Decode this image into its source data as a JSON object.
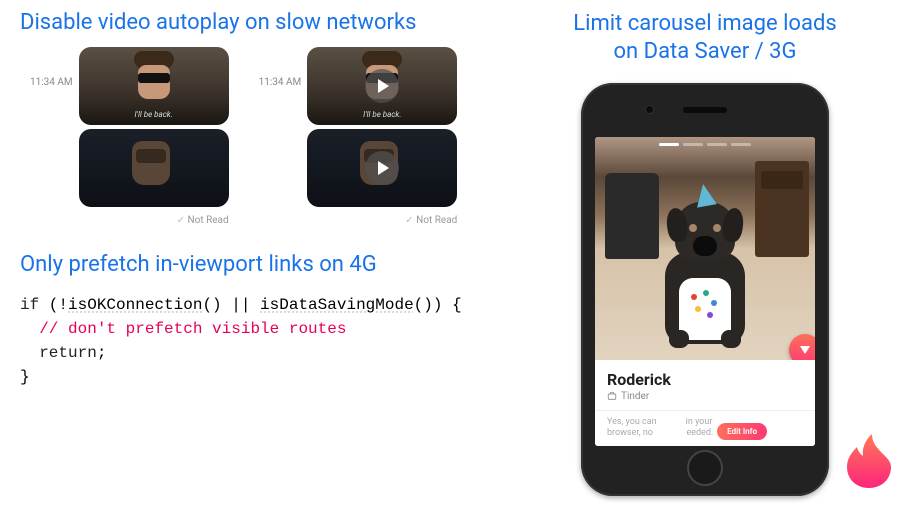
{
  "headings": {
    "autoplay": "Disable video autoplay on slow networks",
    "prefetch": "Only prefetch in-viewport links on 4G",
    "carousel_l1": "Limit carousel image loads",
    "carousel_l2": "on Data Saver / 3G"
  },
  "chat": {
    "timestamp": "11:34 AM",
    "caption": "I'll be back.",
    "read_status": "Not Read"
  },
  "code": {
    "if": "if",
    "bang": " (!",
    "fn1": "isOKConnection",
    "mid": "() || ",
    "fn2": "isDataSavingMode",
    "tail": "()) {",
    "comment": "  // don't prefetch visible routes",
    "return_indent": "  ",
    "return_kw": "return",
    "semi": ";",
    "close": "}"
  },
  "card": {
    "name": "Roderick",
    "meta": "Tinder",
    "blurb_a": "Yes, you can",
    "blurb_b": "in your",
    "blurb_c": "browser, no",
    "blurb_d": "eeded.",
    "edit": "Edit Info"
  }
}
